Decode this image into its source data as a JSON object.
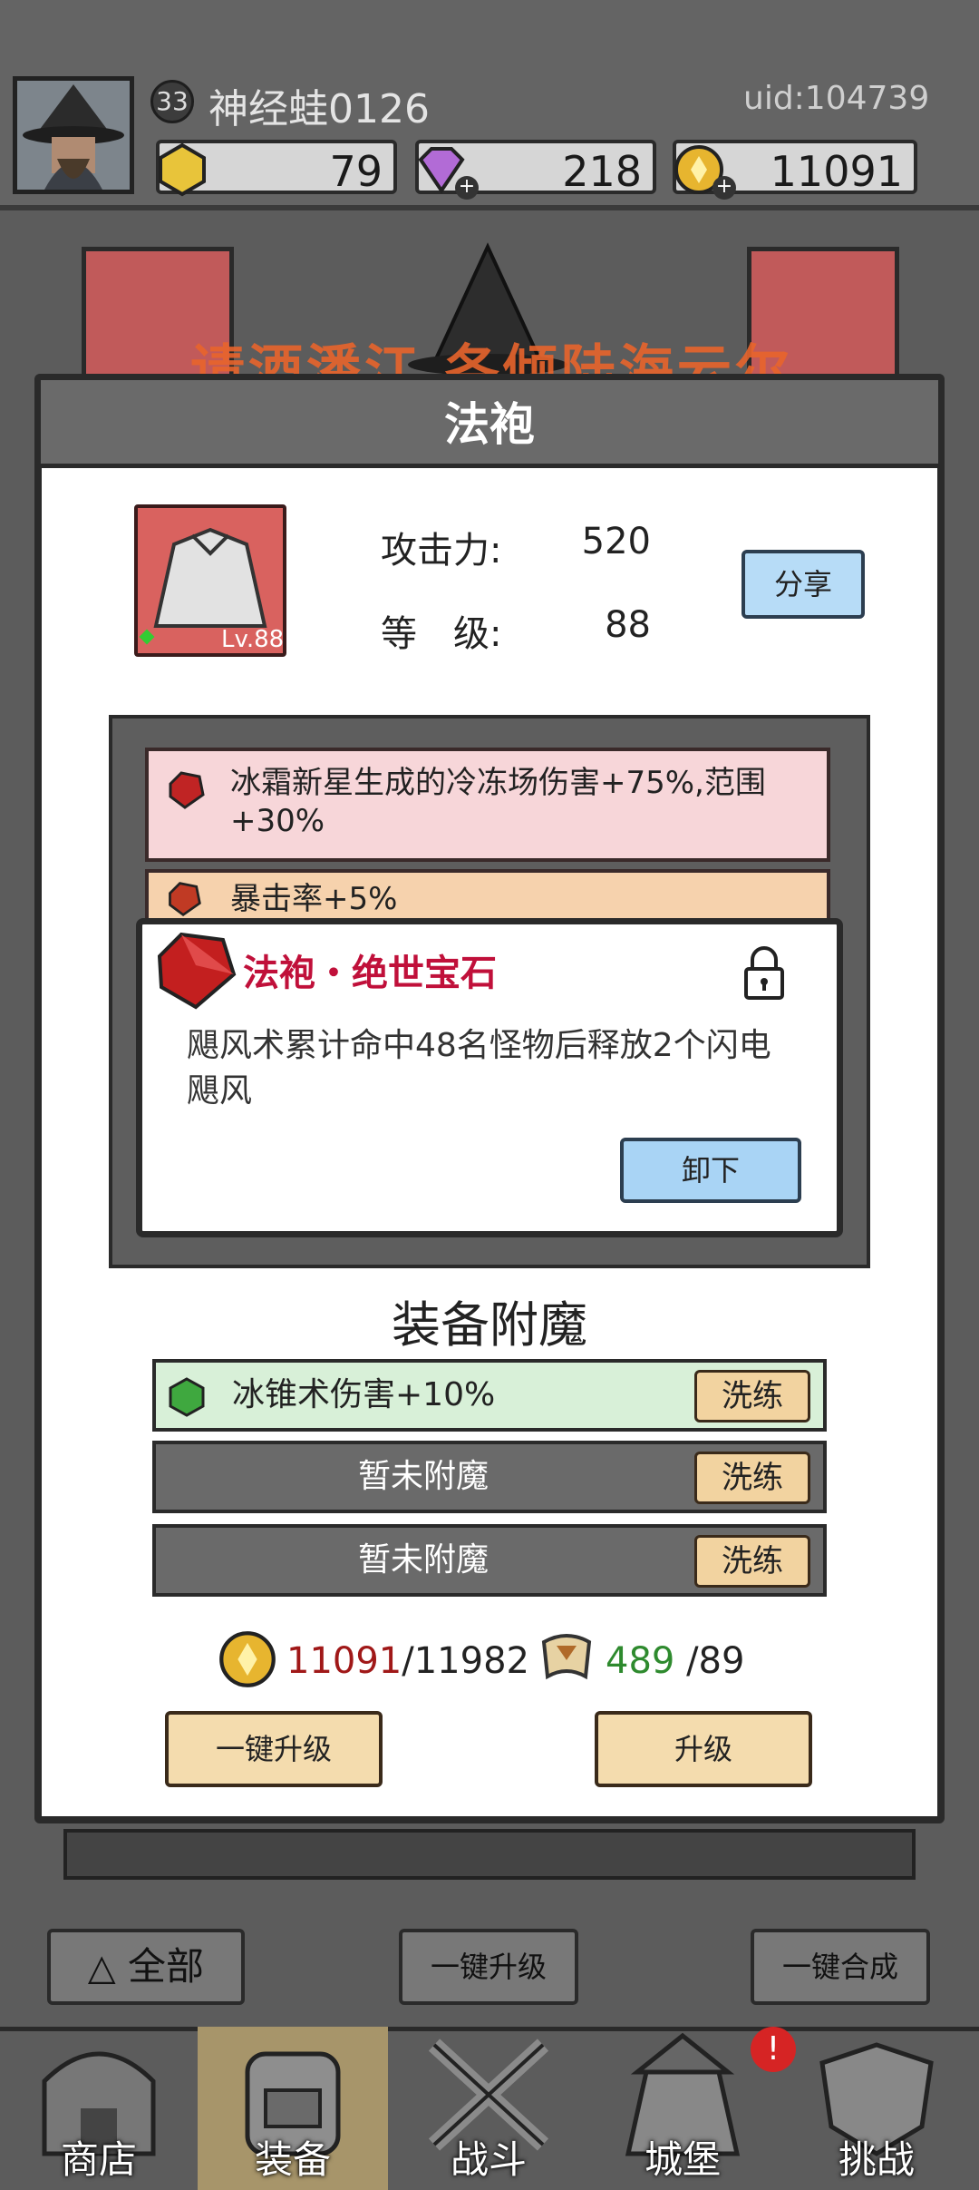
{
  "player": {
    "level": "33",
    "name": "神经蛙0126",
    "uid": "uid:104739",
    "resources": [
      {
        "icon": "gold-coin-icon",
        "value": "79"
      },
      {
        "icon": "purple-gem-icon",
        "value": "218"
      },
      {
        "icon": "coin-icon",
        "value": "11091"
      }
    ]
  },
  "watermark": "请酒潘江 各倾陆海云尔",
  "dialog": {
    "title": "法袍",
    "item_level": "Lv.88",
    "attack_label": "攻击力:",
    "attack_value": "520",
    "level_label": "等　级:",
    "level_value": "88",
    "share_label": "分享",
    "gems": [
      {
        "text": "冰霜新星生成的冷冻场伤害+75%,范围+30%"
      },
      {
        "text": "暴击率+5%"
      }
    ],
    "popup": {
      "title": "法袍・绝世宝石",
      "description": "飓风术累计命中48名怪物后释放2个闪电飓风",
      "unequip_label": "卸下"
    },
    "enchant_title": "装备附魔",
    "enchants": [
      {
        "text": "冰锥术伤害+10%",
        "button": "洗练"
      },
      {
        "text": "暂未附魔",
        "button": "洗练"
      },
      {
        "text": "暂未附魔",
        "button": "洗练"
      }
    ],
    "cost_gold_have": "11091",
    "cost_gold_need": "/11982",
    "cost_scroll_have": "489",
    "cost_scroll_need": " /89",
    "one_key_upgrade": "一键升级",
    "upgrade": "升级"
  },
  "toolbar": {
    "all_label": "全部",
    "upgrade_all": "一键升级",
    "merge_all": "一键合成"
  },
  "nav": [
    {
      "label": "商店"
    },
    {
      "label": "装备"
    },
    {
      "label": "战斗"
    },
    {
      "label": "城堡",
      "badge": "!"
    },
    {
      "label": "挑战"
    }
  ],
  "colors": {
    "red_text": "#a01818",
    "green_text": "#2e8a2e",
    "popup_title": "#c0103a"
  }
}
